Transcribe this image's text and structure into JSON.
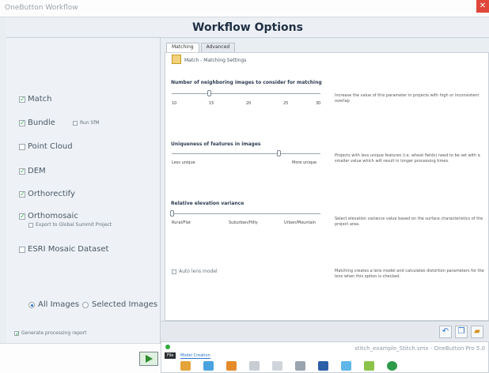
{
  "window": {
    "title": "OneButton Workflow",
    "close_label": "✕"
  },
  "header": {
    "title": "Workflow Options"
  },
  "left_options": {
    "match": {
      "label": "Match",
      "checked": true
    },
    "bundle": {
      "label": "Bundle",
      "checked": true,
      "sub_label": "Run SfM",
      "sub_checked": false
    },
    "point_cloud": {
      "label": "Point Cloud",
      "checked": false
    },
    "dem": {
      "label": "DEM",
      "checked": true
    },
    "orthorectify": {
      "label": "Orthorectify",
      "checked": true
    },
    "orthomosaic": {
      "label": "Orthomosaic",
      "checked": true,
      "sub_label": "Export to Global Summit Project",
      "sub_checked": false
    },
    "esri": {
      "label": "ESRI Mosaic Dataset",
      "checked": false
    },
    "radio_all": "All Images",
    "radio_selected": "Selected Images",
    "report": {
      "label": "Generate processing report",
      "checked": true
    }
  },
  "tabs": [
    {
      "label": "Matching"
    },
    {
      "label": "Advanced"
    }
  ],
  "matching": {
    "section_title": "Match - Matching Settings",
    "neighbors": {
      "label": "Number of neighboring images to consider for matching",
      "ticks": [
        "10",
        "15",
        "20",
        "25",
        "30"
      ],
      "value": 15,
      "description": "Increase the value of this parameter in projects with high or inconsistent overlap"
    },
    "uniqueness": {
      "label": "Uniqueness of features in images",
      "min_label": "Less unique",
      "max_label": "More unique",
      "value_fraction": 0.72,
      "description": "Projects with less unique features (i.e. wheat fields) need to be set with a smaller value which will result in longer processing times."
    },
    "elevation": {
      "label": "Relative elevation variance",
      "ticks": [
        "Rural/Flat",
        "Suburban/Hilly",
        "Urban/Mountain"
      ],
      "value_fraction": 0.0,
      "description": "Select elevation variance value based on the surface characteristics of the project area."
    },
    "auto_lens": {
      "label": "Auto lens model",
      "checked": false
    },
    "auto_lens_description": "Matching creates a lens model and calculates distortion parameters for the lens when this option is checked."
  },
  "taskbar": {
    "status": "stitch_example_Stitch.smx - OneButton Pro 5.0",
    "file_label": "File",
    "model_label": "Model Creation"
  }
}
